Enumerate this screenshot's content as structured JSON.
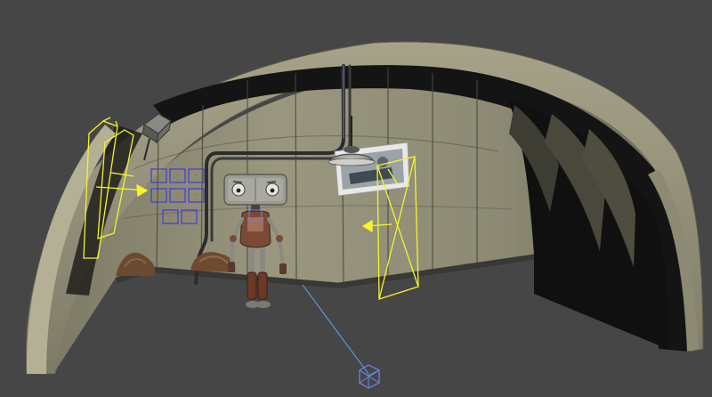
{
  "viewport": {
    "label": "",
    "background": "#464646"
  },
  "scene": {
    "wall_color": "#8f8d78",
    "wall_dark": "#6e6c5a",
    "shell_color": "#9a977f",
    "shadow_color": "#111111",
    "seam_color": "#4a473c",
    "helper_yellow": "#f5f52a",
    "grid_blue": "#3c3cdc",
    "camera_blue": "#6b8cf0",
    "ray_color": "#5aa8f0"
  },
  "objects": [
    {
      "name": "quonset-hut-shell"
    },
    {
      "name": "robot-character"
    },
    {
      "name": "ceiling-lamp"
    },
    {
      "name": "wall-poster"
    },
    {
      "name": "wall-pipes"
    },
    {
      "name": "junction-box"
    },
    {
      "name": "light-grid-array"
    },
    {
      "name": "area-light-left"
    },
    {
      "name": "area-light-right"
    },
    {
      "name": "rock-pile-left"
    },
    {
      "name": "rock-pile-center"
    },
    {
      "name": "camera-target"
    }
  ]
}
